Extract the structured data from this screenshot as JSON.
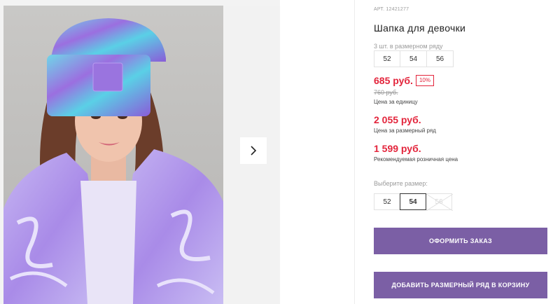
{
  "gallery": {
    "next_icon": "chevron-right-icon",
    "photo_alt": "Шапка для девочки"
  },
  "product": {
    "article": "АРТ. 12421277",
    "title": "Шапка для девочки",
    "pack_note": "3 шт. в размерном ряду",
    "row_sizes": [
      "52",
      "54",
      "56"
    ],
    "price": "685 руб.",
    "discount": "10%",
    "old_price": "760 руб.",
    "unit_price_caption": "Цена за единицу",
    "row_price": "2 055 руб.",
    "row_price_caption": "Цена за размерный ряд",
    "retail_price": "1 599 руб.",
    "retail_price_caption": "Рекомендуемая розничная цена"
  },
  "size_select": {
    "label": "Выберите размер:",
    "options": [
      {
        "label": "52",
        "state": "available"
      },
      {
        "label": "54",
        "state": "selected"
      },
      {
        "label": "56",
        "state": "unavailable"
      }
    ]
  },
  "actions": {
    "order_label": "ОФОРМИТЬ ЗАКАЗ",
    "add_row_label": "ДОБАВИТЬ РАЗМЕРНЫЙ РЯД В КОРЗИНУ"
  },
  "colors": {
    "accent_button": "#7b5fa5",
    "price_red": "#e3253c",
    "muted_text": "#9a9a9a"
  }
}
